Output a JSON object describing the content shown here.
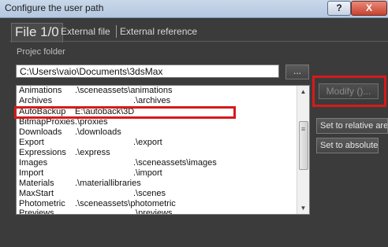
{
  "window": {
    "title": "Configure the user path",
    "help_label": "?",
    "close_label": "X"
  },
  "tabs": [
    {
      "label": "File 1/0"
    },
    {
      "label": "External file"
    },
    {
      "label": "External reference"
    }
  ],
  "project": {
    "section_label": "Projec folder",
    "path_value": "C:\\Users\\vaio\\Documents\\3dsMax",
    "browse_label": "..."
  },
  "paths": [
    {
      "name": "Animations",
      "path": ".\\sceneassets\\animations"
    },
    {
      "name": "Archives",
      "path": ".\\archives"
    },
    {
      "name": "AutoBackup",
      "path": "E:\\autoback\\3D"
    },
    {
      "name": "BitmapProxies",
      "path": ".\\proxies"
    },
    {
      "name": "Downloads",
      "path": ".\\downloads"
    },
    {
      "name": "Export",
      "path": ".\\export"
    },
    {
      "name": "Expressions",
      "path": ".\\express"
    },
    {
      "name": "Images",
      "path": ".\\sceneassets\\images"
    },
    {
      "name": "Import",
      "path": ".\\import"
    },
    {
      "name": "Materials",
      "path": ".\\materiallibraries"
    },
    {
      "name": "MaxStart",
      "path": ".\\scenes"
    },
    {
      "name": "Photometric",
      "path": ".\\sceneassets\\photometric"
    },
    {
      "name": "Previews",
      "path": ".\\previews"
    }
  ],
  "side_buttons": {
    "modify": "Modify ()...",
    "set_relative": "Set to relative area",
    "set_absolute": "Set to absolute"
  },
  "icons": {
    "scroll_up": "▲",
    "scroll_down": "▼",
    "thumb_grip": "≡"
  }
}
